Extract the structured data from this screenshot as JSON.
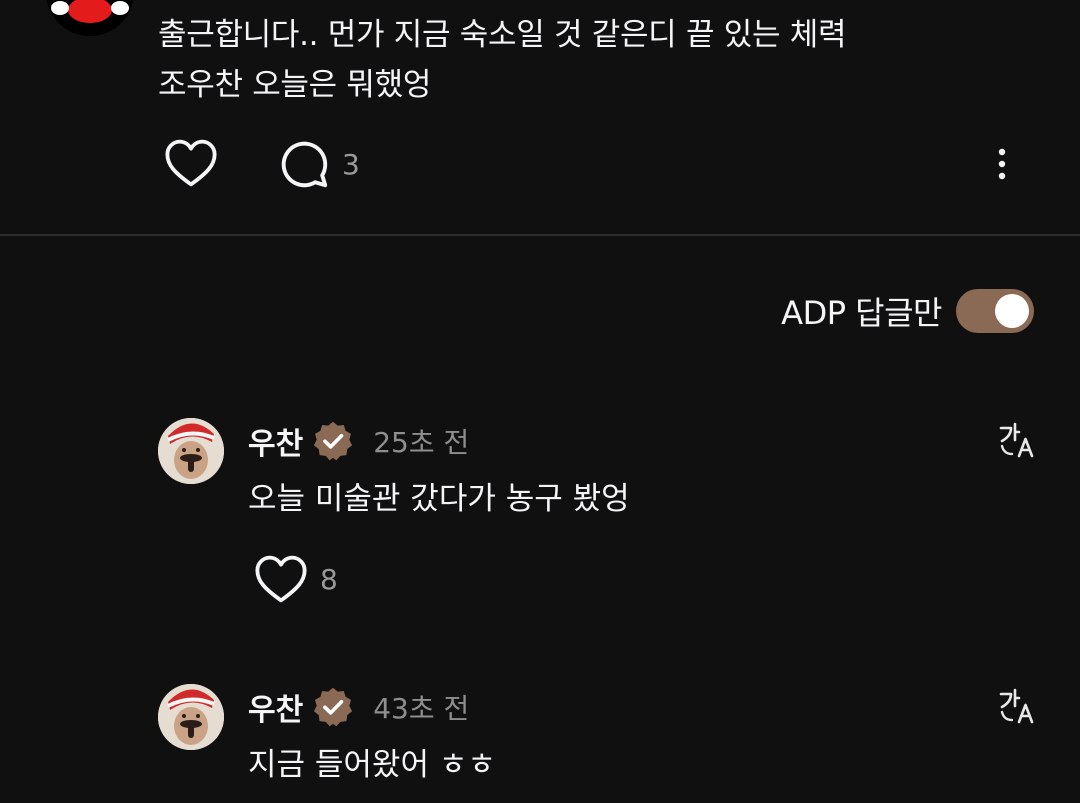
{
  "post": {
    "text_line_1": "출근합니다.. 먼가 지금 숙소일 것 같은디 끝 있는 체력",
    "text_line_2": "조우찬 오늘은 뭐했엉",
    "reply_count": "3"
  },
  "filter": {
    "label": "ADP 답글만",
    "enabled": true
  },
  "replies": [
    {
      "author": "우찬",
      "time": "25초 전",
      "text": "오늘 미술관 갔다가 농구 봤엉",
      "likes": "8"
    },
    {
      "author": "우찬",
      "time": "43초 전",
      "text": "지금 들어왔어 ㅎㅎ"
    }
  ],
  "icons": {
    "like": "heart-icon",
    "reply": "comment-icon",
    "more": "more-vertical-icon",
    "verified": "verified-badge-icon",
    "translate": "translate-icon"
  },
  "colors": {
    "background": "#101010",
    "toggle_on": "#8a6a55",
    "verified_badge": "#8a6a55",
    "muted_text": "#8e8e8e"
  }
}
